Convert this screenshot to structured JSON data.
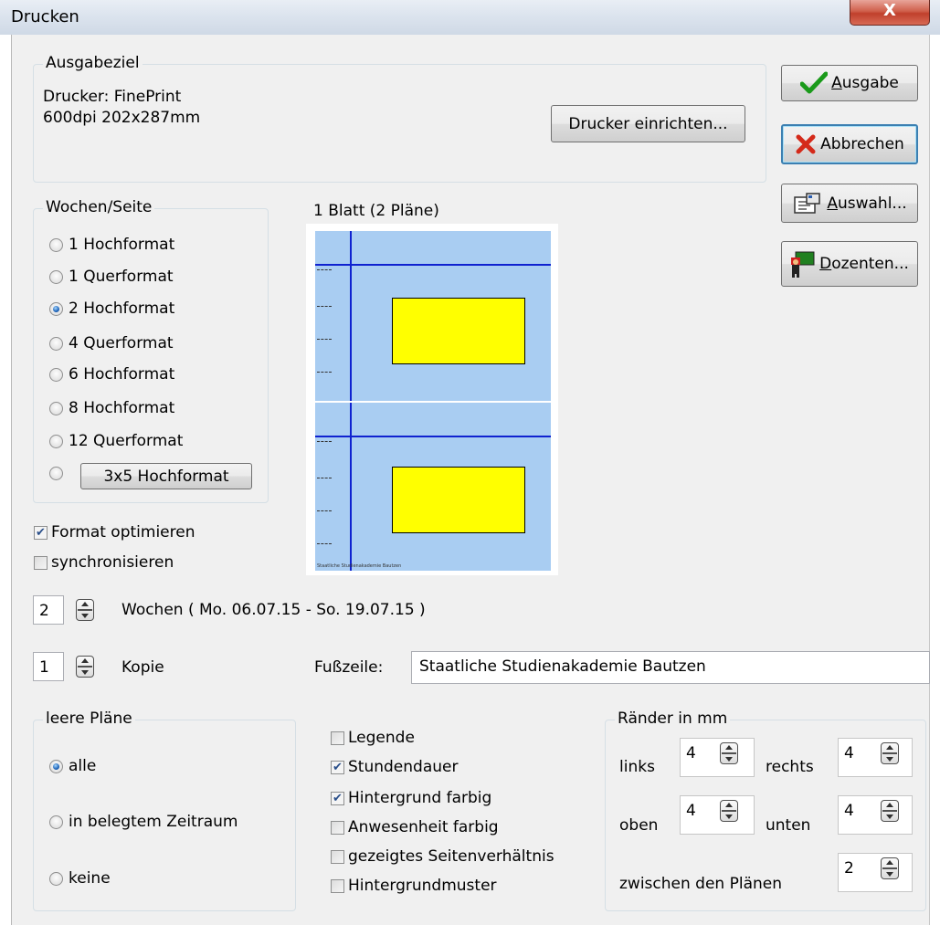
{
  "window": {
    "title": "Drucken",
    "close_glyph": "X"
  },
  "ausgabeziel": {
    "legend": "Ausgabeziel",
    "printer_line": "Drucker: FinePrint",
    "printer_details": "600dpi 202x287mm",
    "setup_button": "Drucker einrichten..."
  },
  "side_buttons": {
    "ausgabe": {
      "underline": "A",
      "rest": "usgabe",
      "icon": "check-icon"
    },
    "abbrechen": {
      "label": "Abbrechen",
      "icon": "x-icon"
    },
    "auswahl": {
      "underline": "A",
      "rest": "uswahl...",
      "icon": "properties-icon"
    },
    "dozenten": {
      "underline": "D",
      "rest": "ozenten...",
      "icon": "teacher-icon"
    }
  },
  "wochen_seite": {
    "legend": "Wochen/Seite",
    "options": [
      "1 Hochformat",
      "1 Querformat",
      "2 Hochformat",
      "4 Querformat",
      "6 Hochformat",
      "8 Hochformat",
      "12 Querformat"
    ],
    "custom_button": "3x5 Hochformat",
    "selected": "2 Hochformat"
  },
  "preview": {
    "label": "1 Blatt (2 Pläne)",
    "footer_tiny": "Staatliche Studienakademie Bautzen"
  },
  "checks_top": {
    "format_optimieren": {
      "label": "Format optimieren",
      "checked": true
    },
    "synchronisieren": {
      "label": "synchronisieren",
      "checked": false
    }
  },
  "weeks": {
    "value": "2",
    "label": "Wochen ( Mo. 06.07.15 - So. 19.07.15 )"
  },
  "copies": {
    "value": "1",
    "label": "Kopie"
  },
  "footer": {
    "label": "Fußzeile:",
    "value": "Staatliche Studienakademie Bautzen"
  },
  "leere_plaene": {
    "legend": "leere Pläne",
    "options": [
      "alle",
      "in belegtem Zeitraum",
      "keine"
    ],
    "selected": "alle"
  },
  "options": [
    {
      "label": "Legende",
      "checked": false
    },
    {
      "label": "Stundendauer",
      "checked": true
    },
    {
      "label": "Hintergrund farbig",
      "checked": true
    },
    {
      "label": "Anwesenheit farbig",
      "checked": false
    },
    {
      "label": "gezeigtes Seitenverhältnis",
      "checked": false
    },
    {
      "label": "Hintergrundmuster",
      "checked": false
    }
  ],
  "raender": {
    "legend": "Ränder in mm",
    "links": {
      "label": "links",
      "value": "4"
    },
    "rechts": {
      "label": "rechts",
      "value": "4"
    },
    "oben": {
      "label": "oben",
      "value": "4"
    },
    "unten": {
      "label": "unten",
      "value": "4"
    },
    "zwischen": {
      "label": "zwischen den Plänen",
      "value": "2"
    }
  },
  "colors": {
    "accent_blue": "#1d63b8",
    "preview_bg": "#a9cdf2",
    "preview_line": "#0f22d0",
    "preview_block": "#ffff00",
    "close_red": "#c0402c"
  }
}
